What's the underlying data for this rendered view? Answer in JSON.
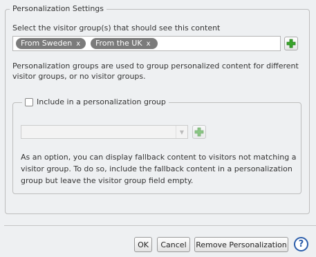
{
  "panel": {
    "legend": "Personalization Settings",
    "select_label": "Select the visitor group(s) that should see this content",
    "tags": [
      {
        "label": "From Sweden",
        "remove": "x"
      },
      {
        "label": "From the UK",
        "remove": "x"
      }
    ],
    "description": "Personalization groups are used to group personalized content for different visitor groups, or no visitor groups."
  },
  "group_section": {
    "checkbox_label": "Include in a personalization group",
    "checked": false,
    "group_select_value": "",
    "description": "As an option, you can display fallback content to visitors not matching a visitor group. To do so, include the fallback content in a personalization group but leave the visitor group field empty."
  },
  "footer": {
    "ok_label": "OK",
    "cancel_label": "Cancel",
    "remove_label": "Remove Personalization",
    "help_label": "?"
  },
  "colors": {
    "background": "#eef0f2",
    "tag": "#7b7b7b",
    "add_icon": "#3aa52b",
    "help": "#2a5caa"
  },
  "icons": {
    "add": "plus-icon",
    "help": "question-icon",
    "dropdown": "chevron-down-icon"
  }
}
